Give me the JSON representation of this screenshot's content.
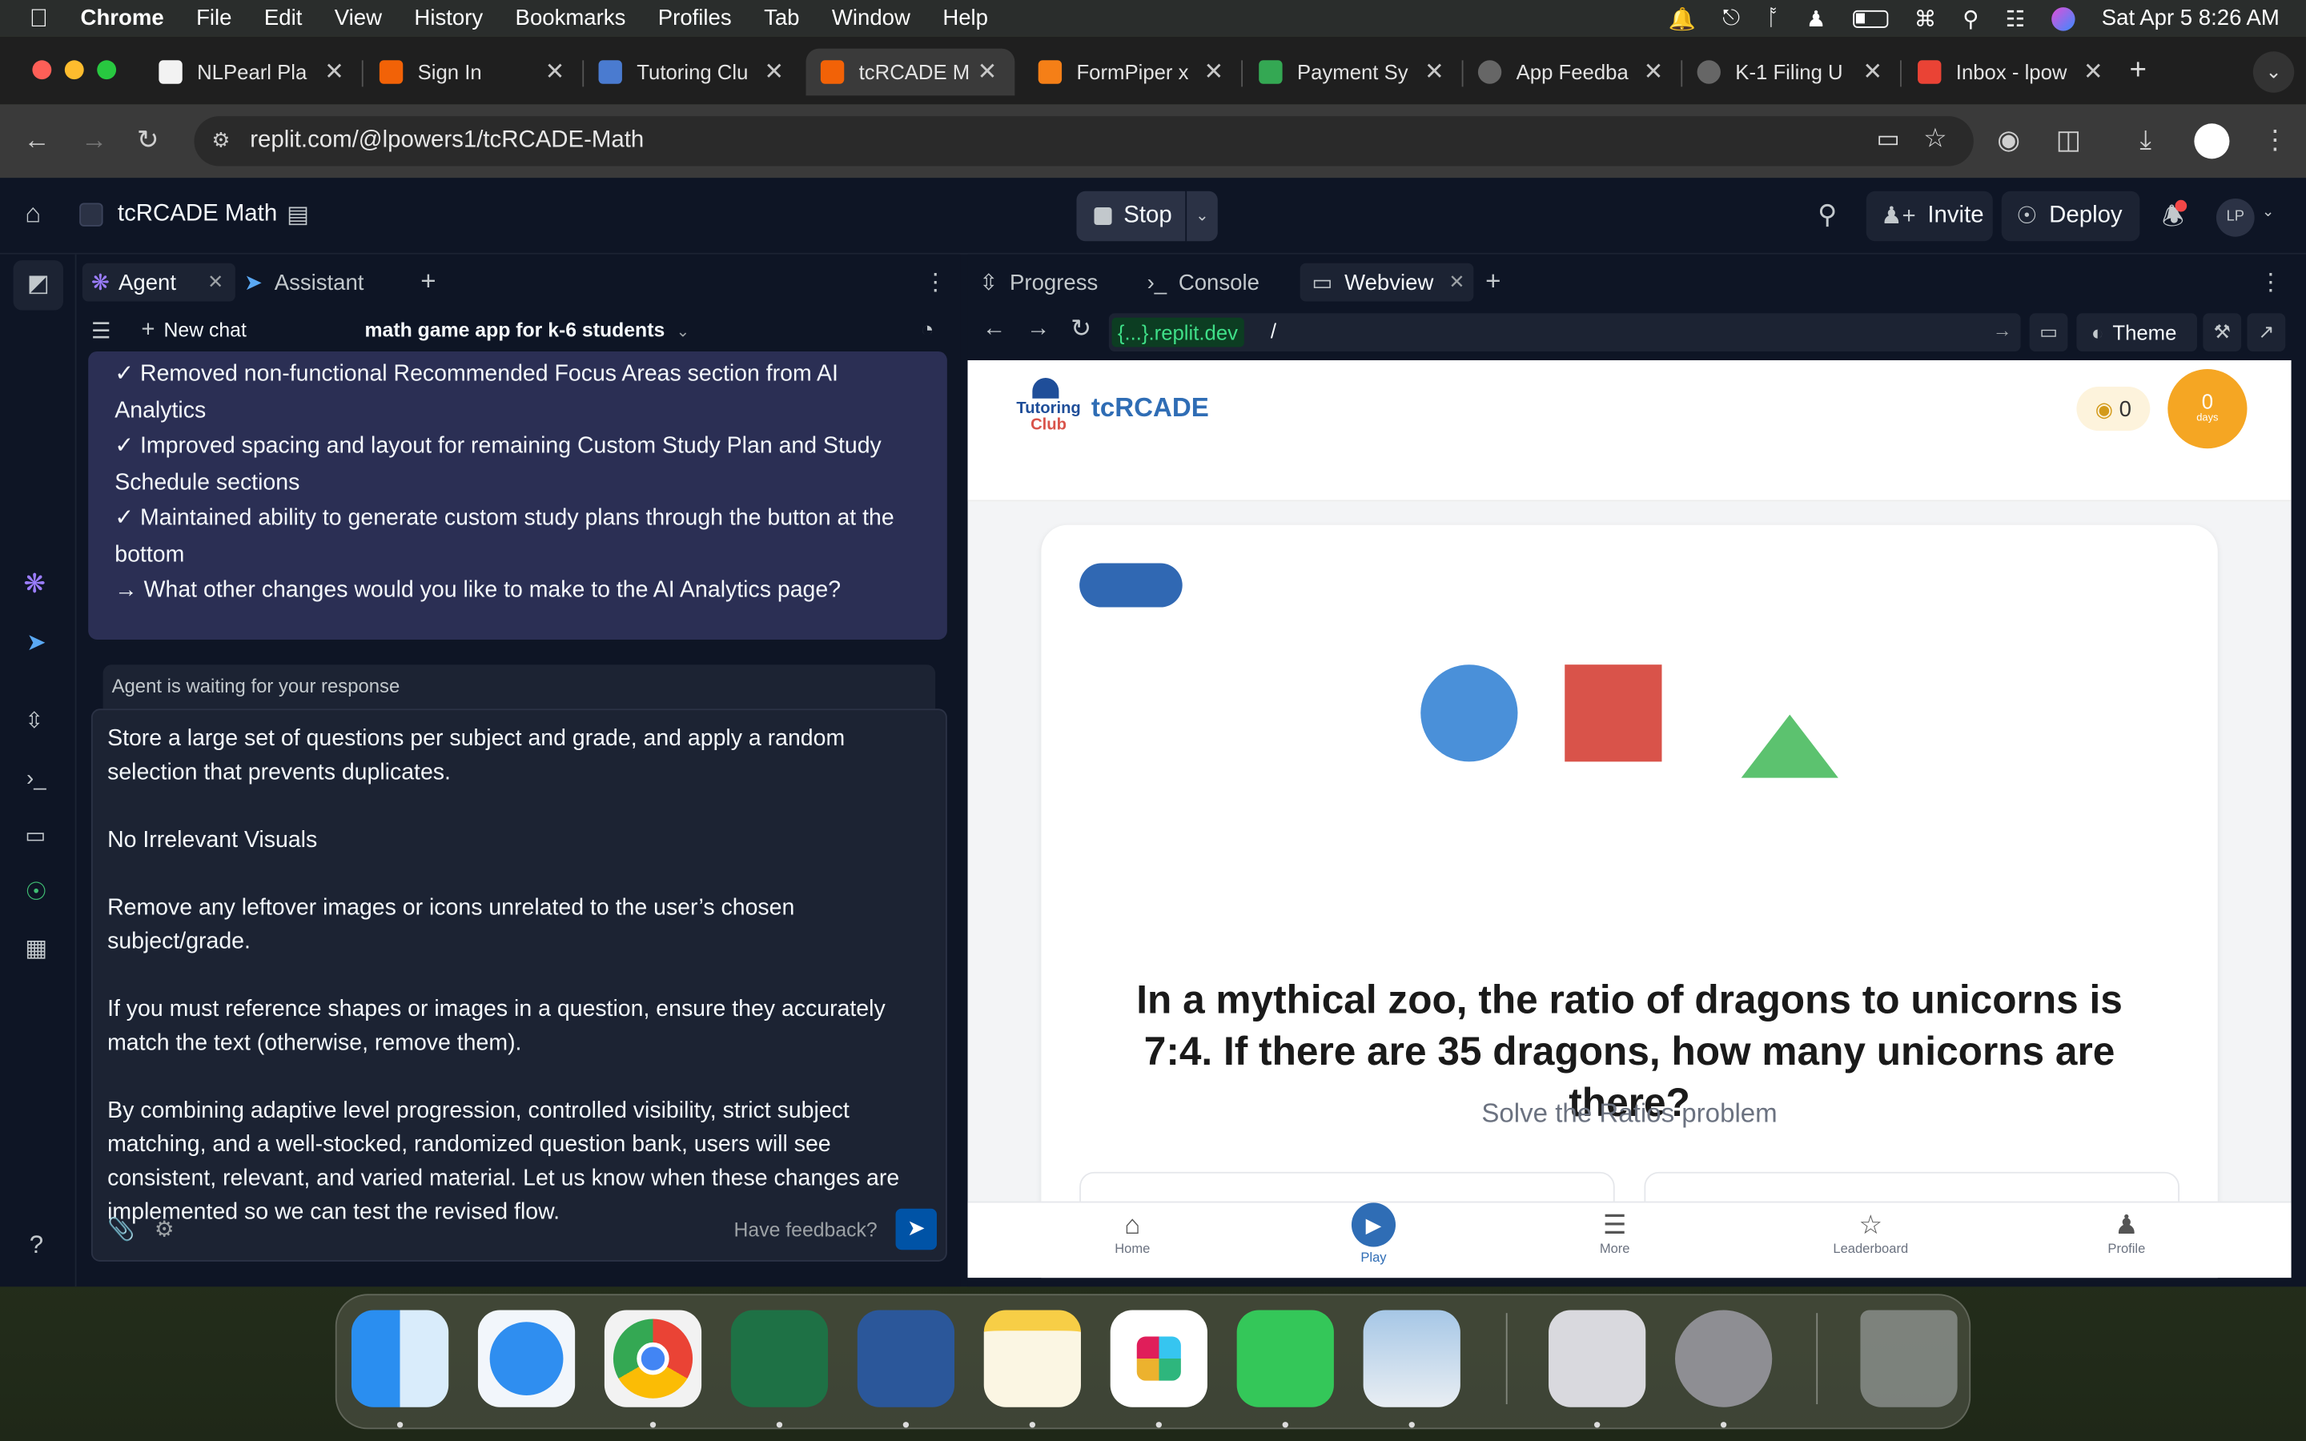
{
  "menubar": {
    "app": "Chrome",
    "items": [
      "File",
      "Edit",
      "View",
      "History",
      "Bookmarks",
      "Profiles",
      "Tab",
      "Window",
      "Help"
    ],
    "clock": "Sat Apr 5  8:26 AM"
  },
  "browser": {
    "tabs": [
      {
        "title": "NLPearl Pla",
        "color": "#222222"
      },
      {
        "title": "Sign In",
        "color": "#f26207"
      },
      {
        "title": "Tutoring Clu",
        "color": "#4a7bd0"
      },
      {
        "title": "tcRCADE M",
        "color": "#f26207"
      },
      {
        "title": "FormPiper x",
        "color": "#f57f17"
      },
      {
        "title": "Payment Sy",
        "color": "#34a853"
      },
      {
        "title": "App Feedba",
        "color": "#555555"
      },
      {
        "title": "K-1 Filing U",
        "color": "#555555"
      },
      {
        "title": "Inbox - lpow",
        "color": "#ea4335"
      }
    ],
    "active_tab_index": 3,
    "url": "replit.com/@lpowers1/tcRCADE-Math"
  },
  "replit": {
    "project_name": "tcRCADE Math",
    "stop_label": "Stop",
    "invite_label": "Invite",
    "deploy_label": "Deploy",
    "avatar_initials": "LP",
    "left_tabs": {
      "agent": "Agent",
      "assistant": "Assistant"
    },
    "new_chat_label": "New chat",
    "chat_title": "math game app for k-6 students",
    "agent_message": [
      "✓ Removed non-functional Recommended Focus Areas section from AI Analytics",
      "✓ Improved spacing and layout for remaining Custom Study Plan and Study Schedule sections",
      "✓ Maintained ability to generate custom study plans through the button at the bottom",
      "→ What other changes would you like to make to the AI Analytics page?"
    ],
    "waiting_label": "Agent is waiting for your response",
    "input_text": "Store a large set of questions per subject and grade, and apply a random selection that prevents duplicates.\n\nNo Irrelevant Visuals\n\nRemove any leftover images or icons unrelated to the user’s chosen subject/grade.\n\nIf you must reference shapes or images in a question, ensure they accurately match the text (otherwise, remove them).\n\nBy combining adaptive level progression, controlled visibility, strict subject matching, and a well-stocked, randomized question bank, users will see consistent, relevant, and varied material. Let us know when these changes are implemented so we can test the revised flow.",
    "feedback_label": "Have feedback?",
    "right_tabs": {
      "progress": "Progress",
      "console": "Console",
      "webview": "Webview"
    },
    "webview_url_host": "{...}.replit.dev",
    "webview_url_path": "/",
    "theme_label": "Theme"
  },
  "app": {
    "logo_line1": "Tutoring",
    "logo_line2": "Club",
    "brand": "tcRCADE",
    "coins": "0",
    "streak_value": "0",
    "streak_unit": "days",
    "question": "In a mythical zoo, the ratio of dragons to unicorns is 7:4. If there are 35 dragons, how many unicorns are there?",
    "subtitle": "Solve the Ratios problem",
    "nav": [
      "Home",
      "Play",
      "More",
      "Leaderboard",
      "Profile"
    ],
    "colors": {
      "brand_blue": "#2f6db5",
      "circle": "#4a90d9",
      "square": "#d9534a",
      "triangle": "#5cc26f",
      "streak": "#f5a623"
    }
  }
}
